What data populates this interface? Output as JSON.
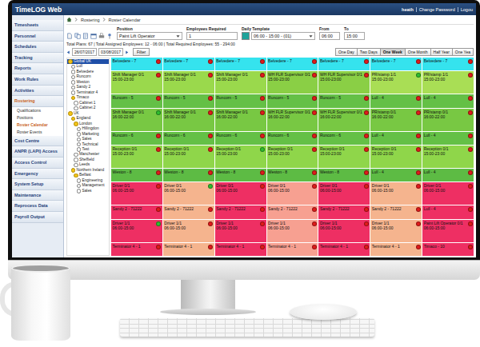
{
  "window": {
    "title": "TimeLOG Web"
  },
  "header": {
    "user": "heath",
    "links": [
      "Change Password",
      "Logou"
    ]
  },
  "sidebar": {
    "items": [
      {
        "label": "Timesheets",
        "selected": false,
        "expanded": false,
        "children": []
      },
      {
        "label": "Personnel",
        "selected": false,
        "expanded": false,
        "children": []
      },
      {
        "label": "Schedules",
        "selected": false,
        "expanded": false,
        "children": []
      },
      {
        "label": "Tracking",
        "selected": false,
        "expanded": false,
        "children": []
      },
      {
        "label": "Reports",
        "selected": false,
        "expanded": false,
        "children": []
      },
      {
        "label": "Work Rules",
        "selected": false,
        "expanded": false,
        "children": []
      },
      {
        "label": "Activities",
        "selected": false,
        "expanded": false,
        "children": []
      },
      {
        "label": "Rostering",
        "selected": true,
        "expanded": true,
        "children": [
          {
            "label": "Qualifications",
            "selected": false
          },
          {
            "label": "Positions",
            "selected": false
          },
          {
            "label": "Roster Calendar",
            "selected": true
          },
          {
            "label": "Roster Events",
            "selected": false
          }
        ]
      },
      {
        "label": "Cost Centre",
        "selected": false,
        "expanded": false,
        "children": []
      },
      {
        "label": "ANPR (LAPI) Access",
        "selected": false,
        "expanded": false,
        "children": []
      },
      {
        "label": "Access Control",
        "selected": false,
        "expanded": false,
        "children": []
      },
      {
        "label": "Emergency",
        "selected": false,
        "expanded": false,
        "children": []
      },
      {
        "label": "System Setup",
        "selected": false,
        "expanded": false,
        "children": []
      },
      {
        "label": "Maintenance",
        "selected": false,
        "expanded": false,
        "children": []
      },
      {
        "label": "Reprocess Data",
        "selected": false,
        "expanded": false,
        "children": []
      },
      {
        "label": "Payroll Output",
        "selected": false,
        "expanded": false,
        "children": []
      }
    ]
  },
  "breadcrumb": [
    "Rostering",
    "Roster Calendar"
  ],
  "filters": [
    {
      "label": "Position",
      "value": "Paint Lift Operator",
      "kind": "select"
    },
    {
      "label": "Employees Required",
      "value": "1",
      "kind": "number"
    },
    {
      "label": "Daily Template",
      "value": "06:00 - 15:00 - (01)",
      "kind": "template"
    },
    {
      "label": "From",
      "value": "06:00",
      "kind": "time"
    },
    {
      "label": "To",
      "value": "15:00",
      "kind": "time"
    }
  ],
  "totals": "Total Plans: 67 | Total Assigned Employees: 12 - 06:00 | Total Required Employees: 55 - 294:00",
  "date_nav": {
    "from": "26/07/2017",
    "to": "03/08/2017",
    "filter": "Filter"
  },
  "views": [
    {
      "label": "One Day",
      "selected": false
    },
    {
      "label": "Two Days",
      "selected": false
    },
    {
      "label": "One Week",
      "selected": true
    },
    {
      "label": "One Month",
      "selected": false
    },
    {
      "label": "Half Year",
      "selected": false
    },
    {
      "label": "One Yea",
      "selected": false
    }
  ],
  "tree": {
    "items": [
      {
        "label": "Global UK",
        "level": 0,
        "selected": true,
        "expanded": true
      },
      {
        "label": "Lull",
        "level": 1,
        "selected": false,
        "expanded": false
      },
      {
        "label": "Belvedere",
        "level": 1,
        "selected": false,
        "expanded": false
      },
      {
        "label": "Runcorn",
        "level": 1,
        "selected": false,
        "expanded": false
      },
      {
        "label": "Weston",
        "level": 1,
        "selected": false,
        "expanded": false
      },
      {
        "label": "Sandy 2",
        "level": 1,
        "selected": false,
        "expanded": false
      },
      {
        "label": "Terminator 4",
        "level": 1,
        "selected": false,
        "expanded": false
      },
      {
        "label": "Timaco",
        "level": 1,
        "selected": false,
        "expanded": true
      },
      {
        "label": "Cabinet 1",
        "level": 2,
        "selected": false,
        "expanded": false
      },
      {
        "label": "Cabinet 2",
        "level": 2,
        "selected": false,
        "expanded": false
      },
      {
        "label": "UK",
        "level": 0,
        "selected": false,
        "expanded": true
      },
      {
        "label": "England",
        "level": 1,
        "selected": false,
        "expanded": true
      },
      {
        "label": "London",
        "level": 2,
        "selected": false,
        "expanded": true
      },
      {
        "label": "Hillingdon",
        "level": 3,
        "selected": false,
        "expanded": false
      },
      {
        "label": "Marketing",
        "level": 3,
        "selected": false,
        "expanded": false
      },
      {
        "label": "Sales",
        "level": 3,
        "selected": false,
        "expanded": false
      },
      {
        "label": "Technical",
        "level": 3,
        "selected": false,
        "expanded": false
      },
      {
        "label": "Test",
        "level": 3,
        "selected": false,
        "expanded": false
      },
      {
        "label": "Manchester",
        "level": 2,
        "selected": false,
        "expanded": false
      },
      {
        "label": "Sheffield",
        "level": 2,
        "selected": false,
        "expanded": false
      },
      {
        "label": "Leeds",
        "level": 2,
        "selected": false,
        "expanded": false
      },
      {
        "label": "Northern Ireland",
        "level": 1,
        "selected": false,
        "expanded": true
      },
      {
        "label": "Belfast",
        "level": 2,
        "selected": false,
        "expanded": true
      },
      {
        "label": "Engineering",
        "level": 3,
        "selected": false,
        "expanded": false
      },
      {
        "label": "Management",
        "level": 3,
        "selected": false,
        "expanded": false
      },
      {
        "label": "Sales",
        "level": 3,
        "selected": false,
        "expanded": false
      }
    ]
  },
  "calendar": {
    "rows": [
      {
        "cells": [
          {
            "title": "Belvedere - 7",
            "time": "",
            "color": "#35e3ee",
            "dot": "#e21b1b"
          },
          {
            "title": "Belvedere - 7",
            "time": "",
            "color": "#35e3ee",
            "dot": "#e21b1b"
          },
          {
            "title": "Belvedere - 7",
            "time": "",
            "color": "#35e3ee",
            "dot": "#e21b1b"
          },
          {
            "title": "Belvedere - 7",
            "time": "",
            "color": "#35e3ee",
            "dot": "#e21b1b"
          },
          {
            "title": "Belvedere - 7",
            "time": "",
            "color": "#35e3ee",
            "dot": "#e21b1b"
          },
          {
            "title": "Belvedere - 7",
            "time": "",
            "color": "#35e3ee",
            "dot": "#e21b1b"
          },
          {
            "title": "Belvedere - 7",
            "time": "",
            "color": "#35e3ee",
            "dot": "#e21b1b"
          }
        ]
      },
      {
        "cells": [
          {
            "title": "Shift Manager 0/1",
            "time": "15:00-23:00",
            "color": "#9ad94c",
            "dot": "#e21b1b"
          },
          {
            "title": "Shift Manager 0/1",
            "time": "15:00-23:00",
            "color": "#9ad94c",
            "dot": "#e21b1b"
          },
          {
            "title": "Shift Manager 0/1",
            "time": "15:00-23:00",
            "color": "#9ad94c",
            "dot": "#e21b1b"
          },
          {
            "title": "WH FLR Supervisor 0/1",
            "time": "15:00-23:00",
            "color": "#8acf45",
            "dot": "#e21b1b"
          },
          {
            "title": "WH FLR Supervisor 0/1",
            "time": "15:00-23:00",
            "color": "#8acf45",
            "dot": "#e21b1b"
          },
          {
            "title": "PR/stamp 1/1",
            "time": "15:00-23:00",
            "color": "#a9de55",
            "dot": "#2fbf2f"
          },
          {
            "title": "PR/stamp 1/1",
            "time": "15:00-23:00",
            "color": "#a9de55",
            "dot": "#e21b1b"
          }
        ]
      },
      {
        "cells": [
          {
            "title": "Runcorn - 5",
            "time": "",
            "color": "#64c046",
            "dot": "#e21b1b"
          },
          {
            "title": "Runcorn - 5",
            "time": "",
            "color": "#64c046",
            "dot": "#e21b1b"
          },
          {
            "title": "Runcorn - 5",
            "time": "",
            "color": "#64c046",
            "dot": "#e21b1b"
          },
          {
            "title": "Runcorn - 5",
            "time": "",
            "color": "#64c046",
            "dot": "#e21b1b"
          },
          {
            "title": "Runcorn - 5",
            "time": "",
            "color": "#64c046",
            "dot": "#e21b1b"
          },
          {
            "title": "Lull - 4",
            "time": "",
            "color": "#64c046",
            "dot": "#e21b1b"
          },
          {
            "title": "Lull - 4",
            "time": "",
            "color": "#64c046",
            "dot": "#e21b1b"
          }
        ]
      },
      {
        "cells": [
          {
            "title": "Shift Manager 0/1",
            "time": "16:00-22:00",
            "color": "#78c843",
            "dot": "#2fbf2f"
          },
          {
            "title": "Shift Manager 0/1",
            "time": "16:00-22:00",
            "color": "#78c843",
            "dot": "#e21b1b"
          },
          {
            "title": "Shift Manager 0/1",
            "time": "16:00-22:00",
            "color": "#78c843",
            "dot": "#e21b1b"
          },
          {
            "title": "WH FLR Supervisor 0/1",
            "time": "16:00-22:00",
            "color": "#78c843",
            "dot": "#e21b1b"
          },
          {
            "title": "WH FLR Supervisor 0/1",
            "time": "16:00-22:00",
            "color": "#78c843",
            "dot": "#e21b1b"
          },
          {
            "title": "PR/stamp 0/1",
            "time": "16:00-22:00",
            "color": "#78c843",
            "dot": "#e21b1b"
          },
          {
            "title": "PR/stamp 0/1",
            "time": "16:00-22:00",
            "color": "#78c843",
            "dot": "#e21b1b"
          }
        ]
      },
      {
        "cells": [
          {
            "title": "Runcorn - 6",
            "time": "",
            "color": "#64c046",
            "dot": "#e21b1b"
          },
          {
            "title": "Runcorn - 6",
            "time": "",
            "color": "#64c046",
            "dot": "#e21b1b"
          },
          {
            "title": "Runcorn - 6",
            "time": "",
            "color": "#64c046",
            "dot": "#e21b1b"
          },
          {
            "title": "Runcorn - 6",
            "time": "",
            "color": "#64c046",
            "dot": "#e21b1b"
          },
          {
            "title": "Runcorn - 6",
            "time": "",
            "color": "#64c046",
            "dot": "#e21b1b"
          },
          {
            "title": "Lull - 4",
            "time": "",
            "color": "#64c046",
            "dot": "#e21b1b"
          },
          {
            "title": "Lull - 4",
            "time": "",
            "color": "#64c046",
            "dot": "#e21b1b"
          }
        ]
      },
      {
        "cells": [
          {
            "title": "Reception 0/1",
            "time": "15:00-23:00",
            "color": "#8fd64a",
            "dot": "#e21b1b"
          },
          {
            "title": "Reception 0/1",
            "time": "15:00-23:00",
            "color": "#8fd64a",
            "dot": "#e21b1b"
          },
          {
            "title": "Reception 0/1",
            "time": "15:00-23:00",
            "color": "#8fd64a",
            "dot": "#2fbf2f"
          },
          {
            "title": "Reception 0/1",
            "time": "15:00-23:00",
            "color": "#8fd64a",
            "dot": "#e21b1b"
          },
          {
            "title": "Reception 0/1",
            "time": "15:00-23:00",
            "color": "#8fd64a",
            "dot": "#e21b1b"
          },
          {
            "title": "Reception 0/1",
            "time": "15:00-23:00",
            "color": "#8fd64a",
            "dot": "#e21b1b"
          },
          {
            "title": "Reception 0/1",
            "time": "15:00-23:00",
            "color": "#8fd64a",
            "dot": "#e21b1b"
          }
        ]
      },
      {
        "cells": [
          {
            "title": "Weston - 8",
            "time": "",
            "color": "#5dbb44",
            "dot": "#e21b1b"
          },
          {
            "title": "Weston - 8",
            "time": "",
            "color": "#5dbb44",
            "dot": "#e21b1b"
          },
          {
            "title": "Weston - 8",
            "time": "",
            "color": "#5dbb44",
            "dot": "#e21b1b"
          },
          {
            "title": "Weston - 8",
            "time": "",
            "color": "#5dbb44",
            "dot": "#e21b1b"
          },
          {
            "title": "Weston - 8",
            "time": "",
            "color": "#5dbb44",
            "dot": "#e21b1b"
          },
          {
            "title": "Lull - 4",
            "time": "",
            "color": "#5dbb44",
            "dot": "#e21b1b"
          },
          {
            "title": "Lull - 4",
            "time": "",
            "color": "#5dbb44",
            "dot": "#e21b1b"
          }
        ]
      },
      {
        "cells": [
          {
            "title": "Driver 0/1",
            "time": "06:00-15:00",
            "color": "#ee2f63",
            "dot": "#e21b1b"
          },
          {
            "title": "Driver 0/1",
            "time": "06:00-15:00",
            "color": "#f5b48e",
            "dot": "#2fbf2f"
          },
          {
            "title": "Driver 0/1",
            "time": "06:00-15:00",
            "color": "#ee2f63",
            "dot": "#e21b1b"
          },
          {
            "title": "Driver 0/1",
            "time": "06:00-15:00",
            "color": "#f7a091",
            "dot": "#e21b1b"
          },
          {
            "title": "Driver 0/1",
            "time": "06:00-15:00",
            "color": "#ee2f63",
            "dot": "#e21b1b"
          },
          {
            "title": "Driver 0/1",
            "time": "06:00-15:00",
            "color": "#f5b48e",
            "dot": "#e21b1b"
          },
          {
            "title": "Driver 0/1",
            "time": "06:00-15:00",
            "color": "#ee2f63",
            "dot": "#e21b1b"
          }
        ]
      },
      {
        "cells": [
          {
            "title": "Sandy 2 - 71222",
            "time": "",
            "color": "#ee2f63",
            "dot": "#e21b1b"
          },
          {
            "title": "Sandy 2 - 71222",
            "time": "",
            "color": "#f5b48e",
            "dot": "#e21b1b"
          },
          {
            "title": "Sandy 2 - 71222",
            "time": "",
            "color": "#ee2f63",
            "dot": "#e21b1b"
          },
          {
            "title": "Sandy 2 - 71222",
            "time": "",
            "color": "#f7a091",
            "dot": "#e21b1b"
          },
          {
            "title": "Sandy 2 - 71222",
            "time": "",
            "color": "#ee2f63",
            "dot": "#e21b1b"
          },
          {
            "title": "Sandy 2 - 71222",
            "time": "",
            "color": "#f5b48e",
            "dot": "#e21b1b"
          },
          {
            "title": "Lull - 4",
            "time": "",
            "color": "#ee2f63",
            "dot": "#e21b1b"
          }
        ]
      },
      {
        "cells": [
          {
            "title": "Driver 1/1",
            "time": "06:00-15:00",
            "color": "#ee2f63",
            "dot": "#2fbf2f"
          },
          {
            "title": "Driver 1/1",
            "time": "06:00-15:00",
            "color": "#f5b48e",
            "dot": "#e21b1b"
          },
          {
            "title": "Driver 1/1",
            "time": "06:00-15:00",
            "color": "#ee2f63",
            "dot": "#e21b1b"
          },
          {
            "title": "Driver 1/1",
            "time": "06:00-15:00",
            "color": "#f7a091",
            "dot": "#e21b1b"
          },
          {
            "title": "Driver 1/1",
            "time": "06:00-15:00",
            "color": "#ee2f63",
            "dot": "#e21b1b"
          },
          {
            "title": "Driver 1/1",
            "time": "06:00-15:00",
            "color": "#f5b48e",
            "dot": "#e21b1b"
          },
          {
            "title": "Paint Lift Operator 0/1",
            "time": "06:00-15:00",
            "color": "#ee2f63",
            "dot": "#e21b1b"
          }
        ]
      },
      {
        "cells": [
          {
            "title": "Terminator 4 - 1",
            "time": "",
            "color": "#ee2f63",
            "dot": "#e21b1b"
          },
          {
            "title": "Terminator 4 - 1",
            "time": "",
            "color": "#f5b48e",
            "dot": "#e21b1b"
          },
          {
            "title": "Terminator 4 - 1",
            "time": "",
            "color": "#ee2f63",
            "dot": "#e21b1b"
          },
          {
            "title": "Terminator 4 - 1",
            "time": "",
            "color": "#f7a091",
            "dot": "#e21b1b"
          },
          {
            "title": "Terminator 4 - 1",
            "time": "",
            "color": "#ee2f63",
            "dot": "#e21b1b"
          },
          {
            "title": "Terminator 4 - 1",
            "time": "",
            "color": "#f5b48e",
            "dot": "#e21b1b"
          },
          {
            "title": "Timaco - 10",
            "time": "",
            "color": "#ee2f63",
            "dot": "#e21b1b"
          }
        ]
      }
    ]
  }
}
